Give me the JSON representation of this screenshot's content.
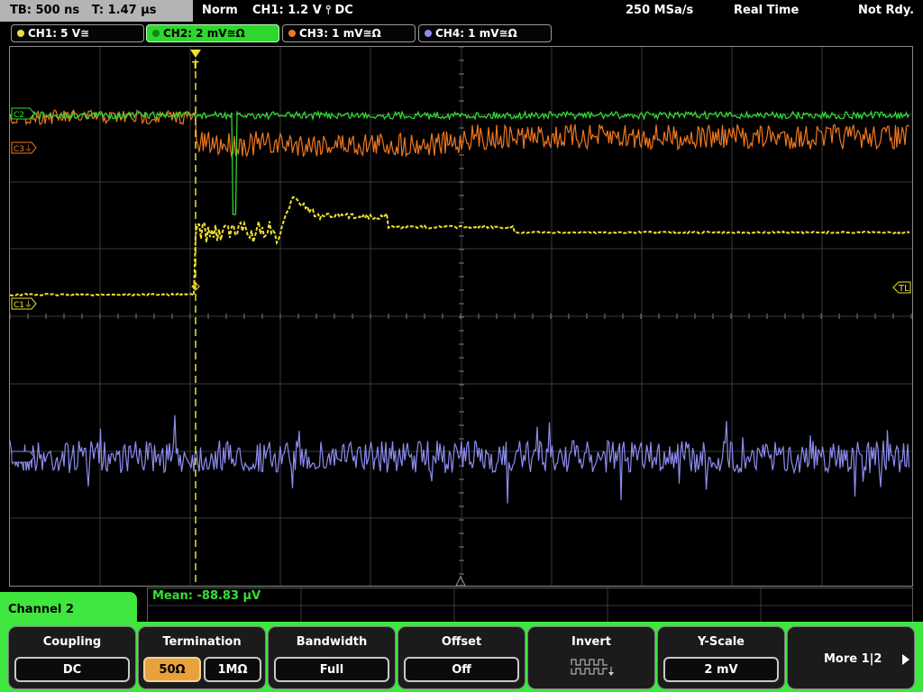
{
  "topbar": {
    "timebase": "TB: 500 ns   T: 1.47 µs",
    "mode": "Norm",
    "trigger": "CH1: 1.2 V ⫯ DC",
    "sample_rate": "250 MSa/s",
    "acq_mode": "Real Time",
    "status": "Not Rdy."
  },
  "channels": [
    {
      "label": "CH1: 5 V≅",
      "color": "#f0e030",
      "active": false
    },
    {
      "label": "CH2: 2 mV≅Ω",
      "color": "#33e033",
      "active": true
    },
    {
      "label": "CH3: 1 mV≅Ω",
      "color": "#f07820",
      "active": false
    },
    {
      "label": "CH4: 1 mV≅Ω",
      "color": "#8c8cf0",
      "active": false
    }
  ],
  "markers": {
    "c3": "C3⏚",
    "c1": "C1⏚",
    "c2": "C2",
    "trigger_level": "TL",
    "trigger_pos": "T"
  },
  "measurement": {
    "text": "Mean: -88.83 µV",
    "color": "#33e033"
  },
  "menu": {
    "channel_label": "Channel 2",
    "coupling": {
      "title": "Coupling",
      "value": "DC"
    },
    "termination": {
      "title": "Termination",
      "options": [
        "50Ω",
        "1MΩ"
      ],
      "selected_index": 0
    },
    "bandwidth": {
      "title": "Bandwidth",
      "value": "Full"
    },
    "offset": {
      "title": "Offset",
      "value": "Off"
    },
    "invert": {
      "title": "Invert",
      "icon": "invert-waveform-icon"
    },
    "yscale": {
      "title": "Y-Scale",
      "value": "2 mV"
    },
    "more": {
      "label": "More 1|2",
      "icon": "arrow-right-icon"
    }
  },
  "colors": {
    "ch1": "#f0e030",
    "ch2": "#33e033",
    "ch3": "#f07820",
    "ch4": "#8c8cf0",
    "menu_accent": "#3ee63e",
    "selected_option": "#e8a23c"
  }
}
